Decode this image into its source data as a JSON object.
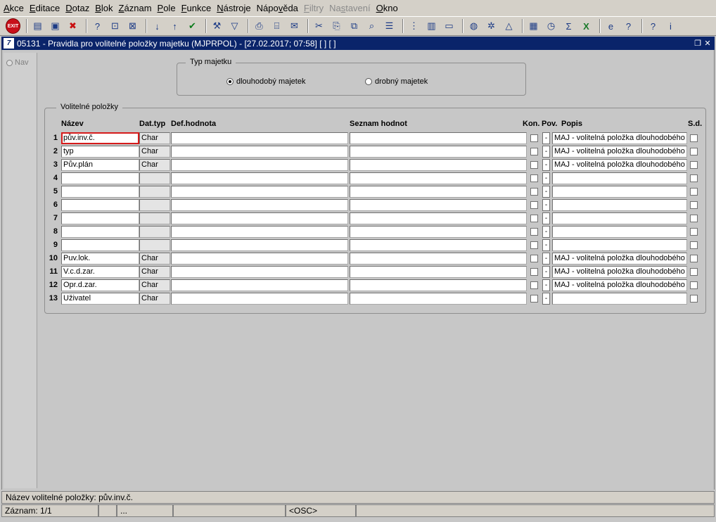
{
  "menu": [
    {
      "label": "Akce",
      "ul": "A"
    },
    {
      "label": "Editace",
      "ul": "E"
    },
    {
      "label": "Dotaz",
      "ul": "D"
    },
    {
      "label": "Blok",
      "ul": "B"
    },
    {
      "label": "Záznam",
      "ul": "Z"
    },
    {
      "label": "Pole",
      "ul": "P"
    },
    {
      "label": "Funkce",
      "ul": "F"
    },
    {
      "label": "Nástroje",
      "ul": "N"
    },
    {
      "label": "Nápověda",
      "ul": "v"
    },
    {
      "label": "Filtry",
      "ul": "F",
      "disabled": true
    },
    {
      "label": "Nastavení",
      "ul": "s",
      "disabled": true
    },
    {
      "label": "Okno",
      "ul": "O"
    }
  ],
  "toolbar": {
    "exit_label": "EXIT",
    "icons": [
      "add-record-icon",
      "save-add-icon",
      "delete-record-icon",
      "query-icon",
      "query-execute-icon",
      "query-cancel-icon",
      "sort-asc-icon",
      "sort-desc-icon",
      "commit-check-icon",
      "wrench-icon",
      "filter-icon",
      "print-icon",
      "print-setup-icon",
      "mail-icon",
      "cut-icon",
      "paste-icon",
      "copy-icon",
      "find-icon",
      "list-icon",
      "tree-icon",
      "clipboard-icon",
      "document-icon",
      "globe-icon",
      "ship-wheel-icon",
      "triangle-icon",
      "report-icon",
      "history-icon",
      "sum-icon",
      "excel-icon",
      "ie-icon",
      "help-icon",
      "context-help-icon",
      "info-icon"
    ]
  },
  "window": {
    "title": "05131 - Pravidla pro volitelné položky majetku (MJPRPOL) - [27.02.2017; 07:58]  [ ] [ ]",
    "icon_letter": "7"
  },
  "nav": {
    "label": "Nav"
  },
  "typ_majetku": {
    "legend": "Typ majetku",
    "options": [
      "dlouhodobý majetek",
      "drobný majetek"
    ],
    "selected": 0
  },
  "volitelne": {
    "legend": "Volitelné položky",
    "headers": {
      "nazev": "Název",
      "dattyp": "Dat.typ",
      "def": "Def.hodnota",
      "seznam": "Seznam hodnot",
      "kon": "Kon.",
      "pov": "Pov.",
      "popis": "Popis",
      "sd": "S.d."
    },
    "rows": [
      {
        "num": "1",
        "nazev": "pův.inv.č.",
        "dattyp": "Char",
        "pov": "-",
        "popis": "MAJ - volitelná položka dlouhodobého m"
      },
      {
        "num": "2",
        "nazev": "typ",
        "dattyp": "Char",
        "pov": "-",
        "popis": "MAJ - volitelná položka dlouhodobého m"
      },
      {
        "num": "3",
        "nazev": "Pův.plán",
        "dattyp": "Char",
        "pov": "-",
        "popis": "MAJ - volitelná položka dlouhodobého m"
      },
      {
        "num": "4",
        "nazev": "",
        "dattyp": "",
        "pov": "-",
        "popis": ""
      },
      {
        "num": "5",
        "nazev": "",
        "dattyp": "",
        "pov": "-",
        "popis": ""
      },
      {
        "num": "6",
        "nazev": "",
        "dattyp": "",
        "pov": "-",
        "popis": ""
      },
      {
        "num": "7",
        "nazev": "",
        "dattyp": "",
        "pov": "-",
        "popis": ""
      },
      {
        "num": "8",
        "nazev": "",
        "dattyp": "",
        "pov": "-",
        "popis": ""
      },
      {
        "num": "9",
        "nazev": "",
        "dattyp": "",
        "pov": "-",
        "popis": ""
      },
      {
        "num": "10",
        "nazev": "Puv.lok.",
        "dattyp": "Char",
        "pov": "-",
        "popis": "MAJ - volitelná položka dlouhodobého m"
      },
      {
        "num": "11",
        "nazev": "V.c.d.zar.",
        "dattyp": "Char",
        "pov": "-",
        "popis": "MAJ - volitelná položka dlouhodobého m"
      },
      {
        "num": "12",
        "nazev": "Opr.d.zar.",
        "dattyp": "Char",
        "pov": "-",
        "popis": "MAJ - volitelná položka dlouhodobého m"
      },
      {
        "num": "13",
        "nazev": "Uživatel",
        "dattyp": "Char",
        "pov": "-",
        "popis": ""
      }
    ]
  },
  "hint": "Název volitelné položky: pův.inv.č.",
  "status": {
    "record": "Záznam: 1/1",
    "seg3": "...",
    "osc": "<OSC>"
  }
}
